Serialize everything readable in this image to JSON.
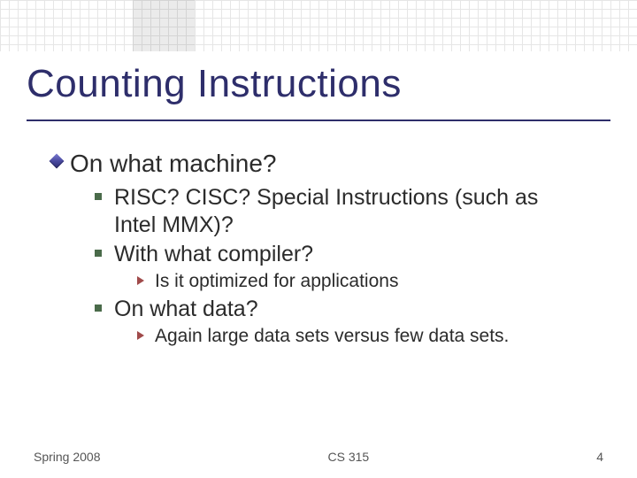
{
  "title": "Counting Instructions",
  "bullets": {
    "l1_0": "On what machine?",
    "l2_0": "RISC? CISC? Special Instructions (such as Intel MMX)?",
    "l2_1": "With what compiler?",
    "l3_0": "Is it optimized for applications",
    "l2_2": "On what data?",
    "l3_1": "Again large data sets versus few data sets."
  },
  "footer": {
    "left": "Spring 2008",
    "center": "CS 315",
    "right": "4"
  }
}
